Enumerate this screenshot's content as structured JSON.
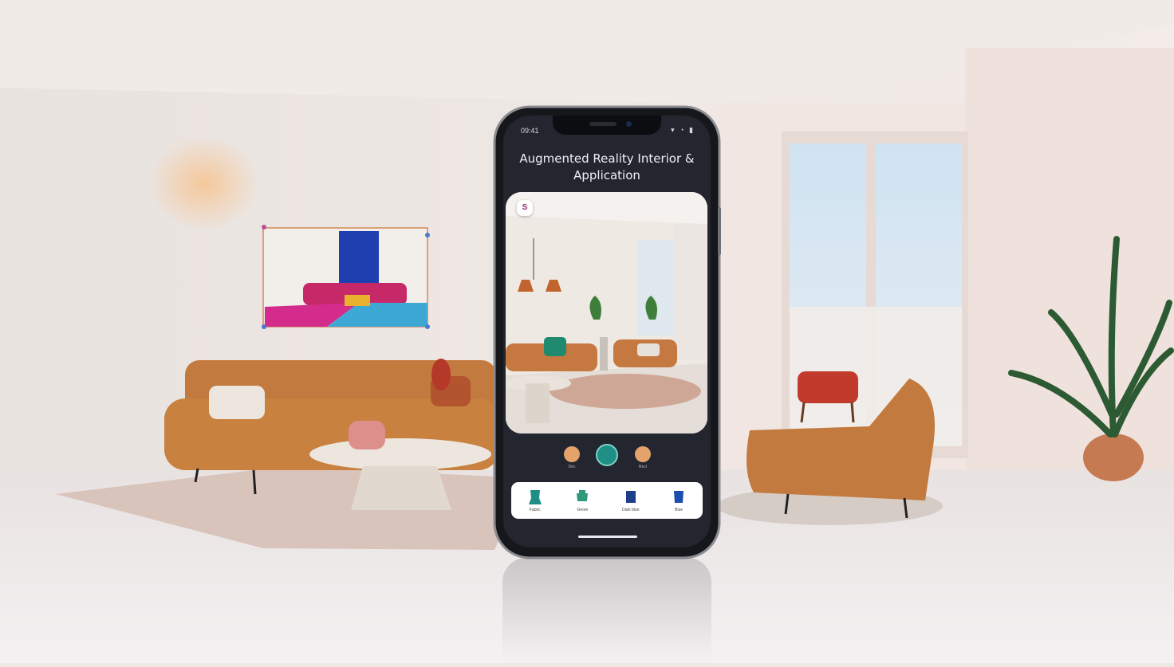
{
  "status_bar": {
    "time": "09:41",
    "icons": "▾ ◔ ▮"
  },
  "app": {
    "title_line1": "Augmented Reality Interior &",
    "title_line2": "Application",
    "ar_badge": "S"
  },
  "controls": [
    {
      "label": "Dec",
      "icon": "circle"
    },
    {
      "label": "",
      "icon": "ar-scan-icon"
    },
    {
      "label": "Rect",
      "icon": "circle"
    }
  ],
  "tray_items": [
    {
      "label": "Fabric",
      "icon": "teal-chair-icon",
      "color": "#1f8f86"
    },
    {
      "label": "Green",
      "icon": "green-chair-icon",
      "color": "#2f9a7a"
    },
    {
      "label": "Dark blue",
      "icon": "blue-chair-icon",
      "color": "#1d3f8a"
    },
    {
      "label": "Blue",
      "icon": "blue-chair-icon",
      "color": "#1a4fb0"
    }
  ],
  "colors": {
    "accent": "#1f8f86",
    "phone_screen": "#23252f",
    "wall": "#efe7e2",
    "sofa": "#c37a3e"
  }
}
